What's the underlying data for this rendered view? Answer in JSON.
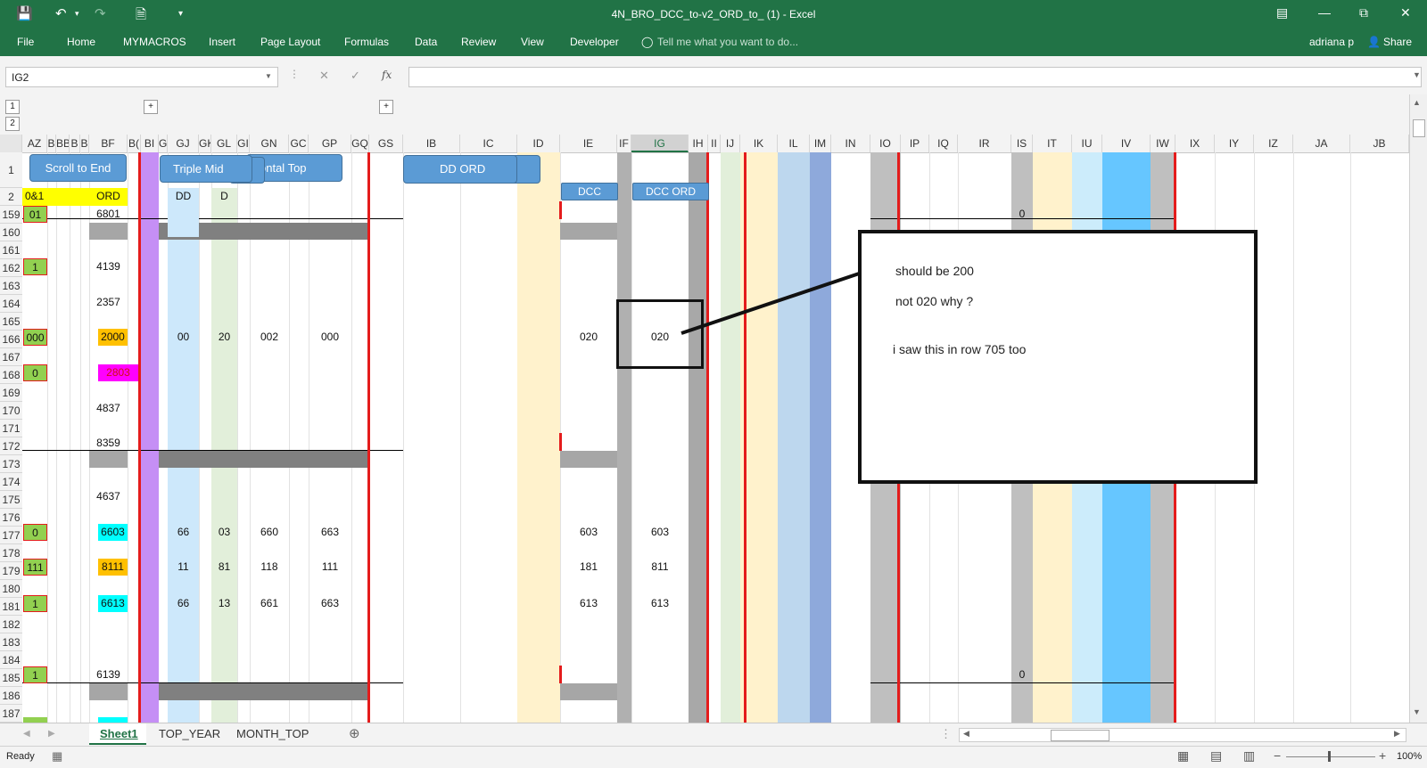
{
  "window": {
    "title": "4N_BRO_DCC_to-v2_ORD_to_ (1) - Excel",
    "user": "adriana p",
    "share_label": "Share"
  },
  "ribbon": {
    "tabs": [
      "File",
      "Home",
      "MYMACROS",
      "Insert",
      "Page Layout",
      "Formulas",
      "Data",
      "Review",
      "View",
      "Developer"
    ],
    "tell_me": "Tell me what you want to do..."
  },
  "formula_bar": {
    "name_box": "IG2",
    "fx": "fx",
    "value": ""
  },
  "outline": {
    "levels": [
      "1",
      "2"
    ],
    "expand": "+"
  },
  "columns": [
    "AZ",
    "B",
    "BB",
    "B",
    "B",
    "BF",
    "B(",
    "BI",
    "G",
    "GJ",
    "GK",
    "GL",
    "GI",
    "GN",
    "GC",
    "GP",
    "GQ",
    "GS",
    "IB",
    "IC",
    "ID",
    "IE",
    "IF",
    "IG",
    "IH",
    "II",
    "IJ",
    "IK",
    "IL",
    "IM",
    "IN",
    "IO",
    "IP",
    "IQ",
    "IR",
    "IS",
    "IT",
    "IU",
    "IV",
    "IW",
    "IX",
    "IY",
    "IZ",
    "JA",
    "JB"
  ],
  "selected_column": "IG",
  "rows": [
    "1",
    "2",
    "159",
    "160",
    "161",
    "162",
    "163",
    "164",
    "165",
    "166",
    "167",
    "168",
    "169",
    "170",
    "171",
    "172",
    "173",
    "174",
    "175",
    "176",
    "177",
    "178",
    "179",
    "180",
    "181",
    "182",
    "183",
    "184",
    "185",
    "186",
    "187"
  ],
  "buttons": {
    "scroll_to_end": "Scroll to End",
    "triple_mid": "Triple Mid",
    "ontal_top": "ontal Top",
    "dd_ord": "DD ORD",
    "dcc": "DCC",
    "dcc_ord": "DCC ORD"
  },
  "headers_row2": {
    "az": "0&1",
    "bf": "ORD",
    "gj": "DD",
    "gl": "D"
  },
  "cells": {
    "r159": {
      "az": "01",
      "bf": "6801",
      "is": "0"
    },
    "r162": {
      "az": "1",
      "bf": "4139"
    },
    "r164": {
      "bf": "2357"
    },
    "r166": {
      "az": "000",
      "bf": "2000",
      "gj": "00",
      "gl": "20",
      "gn": "002",
      "gp": "000",
      "ie": "020",
      "ig": "020"
    },
    "r168": {
      "az": "0",
      "bf": "2803"
    },
    "r170": {
      "bf": "4837"
    },
    "r172": {
      "bf": "8359"
    },
    "r175": {
      "bf": "4637"
    },
    "r177": {
      "az": "0",
      "bf": "6603",
      "gj": "66",
      "gl": "03",
      "gn": "660",
      "gp": "663",
      "ie": "603",
      "ig": "603"
    },
    "r179": {
      "az": "111",
      "bf": "8111",
      "gj": "11",
      "gl": "81",
      "gn": "118",
      "gp": "111",
      "ie": "181",
      "ig": "811"
    },
    "r181": {
      "az": "1",
      "bf": "6613",
      "gj": "66",
      "gl": "13",
      "gn": "661",
      "gp": "663",
      "ie": "613",
      "ig": "613"
    },
    "r185": {
      "az": "1",
      "bf": "6139",
      "is": "0"
    }
  },
  "callout": {
    "line1": "should be  200",
    "line2": "not 020 why ?",
    "line3": "i saw this  in row 705 too"
  },
  "sheet_tabs": [
    "Sheet1",
    "TOP_YEAR",
    "MONTH_TOP"
  ],
  "active_sheet": "Sheet1",
  "status": {
    "ready": "Ready",
    "zoom": "100%"
  },
  "colors": {
    "excel_green": "#217346",
    "red_border": "#e41c1c",
    "yellow": "#ffff00",
    "orange": "#ffc000",
    "magenta": "#ff00ff",
    "cyan": "#00ffff",
    "green_fill": "#92d050"
  }
}
